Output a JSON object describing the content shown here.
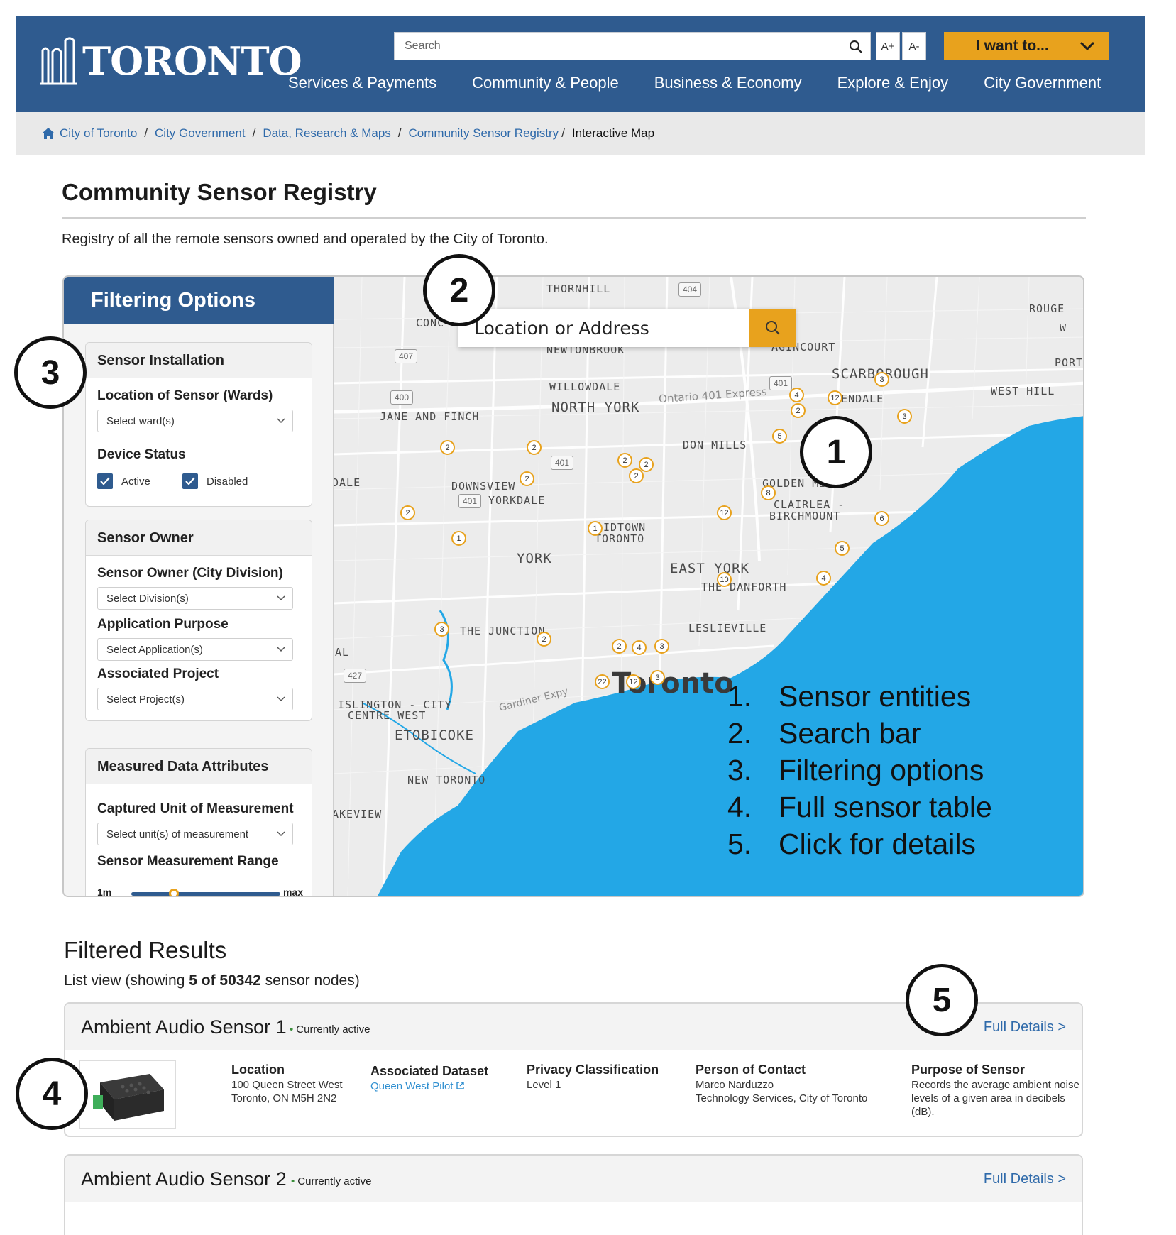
{
  "header": {
    "logo_text": "TORONTO",
    "search_placeholder": "Search",
    "font_increase": "A+",
    "font_decrease": "A-",
    "i_want_to": "I want to...",
    "nav": [
      "Services & Payments",
      "Community & People",
      "Business & Economy",
      "Explore & Enjoy",
      "City Government"
    ]
  },
  "breadcrumb": {
    "items": [
      "City of Toronto",
      "City Government",
      "Data, Research & Maps",
      "Community Sensor Registry"
    ],
    "current": "Interactive Map",
    "separator": "/"
  },
  "page": {
    "title": "Community Sensor Registry",
    "description": "Registry of all the remote sensors owned and operated by the City of Toronto."
  },
  "filters": {
    "heading": "Filtering Options",
    "installation": {
      "title": "Sensor Installation",
      "location_label": "Location of Sensor (Wards)",
      "location_placeholder": "Select ward(s)",
      "status_label": "Device Status",
      "active_label": "Active",
      "active_checked": true,
      "disabled_label": "Disabled",
      "disabled_checked": true
    },
    "owner": {
      "title": "Sensor Owner",
      "division_label": "Sensor Owner (City Division)",
      "division_placeholder": "Select Division(s)",
      "purpose_label": "Application Purpose",
      "purpose_placeholder": "Select Application(s)",
      "project_label": "Associated Project",
      "project_placeholder": "Select Project(s)"
    },
    "measured": {
      "title": "Measured Data Attributes",
      "unit_label": "Captured Unit of Measurement",
      "unit_placeholder": "Select unit(s) of measurement",
      "range_label": "Sensor Measurement Range",
      "range_min": "1m",
      "range_max": "max",
      "range_value_fraction": 0.3
    }
  },
  "map": {
    "search_placeholder": "Location or Address",
    "city_label": "Toronto",
    "places_large": [
      "NORTH YORK",
      "SCARBOROUGH",
      "YORK",
      "EAST YORK",
      "ETOBICOKE"
    ],
    "places_small": [
      "THORNHILL",
      "CONC",
      "NEWTONBROOK",
      "AGINCOURT",
      "ROUGE",
      "PORT",
      "WEST HILL",
      "BENDALE",
      "WILLOWDALE",
      "JANE AND FINCH",
      "DON MILLS",
      "DOWNSVIEW",
      "YORKDALE",
      "DALE",
      "GOLDEN MILE",
      "CLAIRLEA -",
      "BIRCHMOUNT",
      "IDTOWN",
      "TORONTO",
      "THE DANFORTH",
      "LESLIEVILLE",
      "THE JUNCTION",
      "AL",
      "ISLINGTON - CITY",
      "CENTRE WEST",
      "NEW TORONTO",
      "AKEVIEW",
      "W"
    ],
    "road_label": "Ontario 401 Express",
    "road_label_2": "Gardiner Expy",
    "highway_shields": [
      "404",
      "407",
      "400",
      "401",
      "401",
      "401",
      "427"
    ],
    "markers": [
      "3",
      "4",
      "12",
      "3",
      "5",
      "2",
      "2",
      "2",
      "2",
      "2",
      "2",
      "2",
      "2",
      "8",
      "12",
      "6",
      "2",
      "1",
      "1",
      "5",
      "10",
      "4",
      "3",
      "2",
      "2",
      "4",
      "3",
      "22",
      "12",
      "3"
    ]
  },
  "legend": {
    "items": [
      {
        "num": "1.",
        "text": "Sensor entities"
      },
      {
        "num": "2.",
        "text": "Search bar"
      },
      {
        "num": "3.",
        "text": "Filtering options"
      },
      {
        "num": "4.",
        "text": "Full sensor table"
      },
      {
        "num": "5.",
        "text": "Click for details"
      }
    ]
  },
  "callouts": [
    "1",
    "2",
    "3",
    "4",
    "5"
  ],
  "results": {
    "title": "Filtered Results",
    "count_prefix": "List view (showing ",
    "count_bold": "5 of 50342",
    "count_suffix": " sensor nodes)",
    "sensors": [
      {
        "name": "Ambient Audio Sensor 1",
        "status": "Currently active",
        "link": "Full Details >",
        "location_label": "Location",
        "location_line1": "100 Queen Street West",
        "location_line2": "Toronto, ON M5H 2N2",
        "dataset_label": "Associated Dataset",
        "dataset_value": "Queen West Pilot",
        "privacy_label": "Privacy Classification",
        "privacy_value": "Level 1",
        "contact_label": "Person of Contact",
        "contact_name": "Marco Narduzzo",
        "contact_org": "Technology Services, City of Toronto",
        "purpose_label": "Purpose of Sensor",
        "purpose_line1": "Records the average ambient noise",
        "purpose_line2": "levels of a given area in decibels (dB)."
      },
      {
        "name": "Ambient Audio Sensor 2",
        "status": "Currently active",
        "link": "Full Details >"
      }
    ]
  },
  "colors": {
    "brand_blue": "#2f5b8f",
    "accent_orange": "#e8a21d",
    "water": "#23a7e6",
    "link_blue": "#2f6aaa",
    "status_green": "#3a8e3a"
  }
}
